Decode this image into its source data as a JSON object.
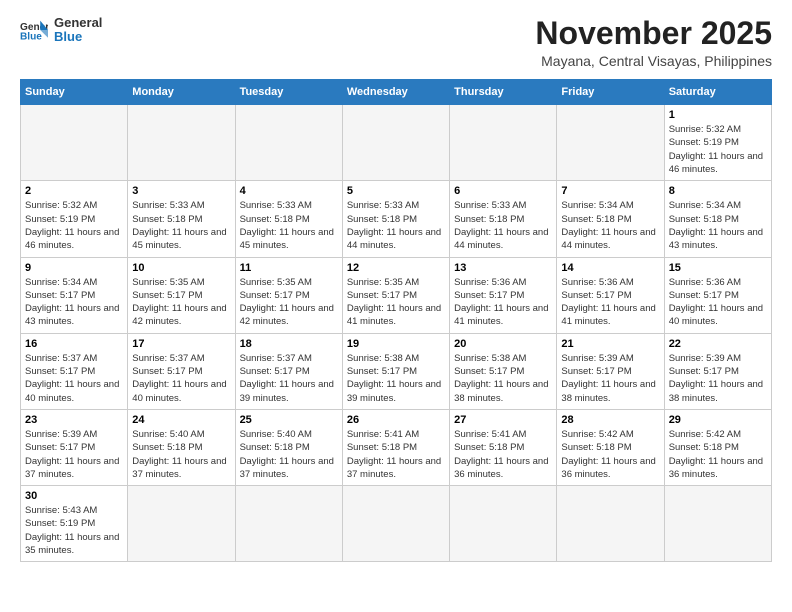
{
  "header": {
    "logo_general": "General",
    "logo_blue": "Blue",
    "month_title": "November 2025",
    "location": "Mayana, Central Visayas, Philippines"
  },
  "days_of_week": [
    "Sunday",
    "Monday",
    "Tuesday",
    "Wednesday",
    "Thursday",
    "Friday",
    "Saturday"
  ],
  "weeks": [
    [
      {
        "day": "",
        "empty": true
      },
      {
        "day": "",
        "empty": true
      },
      {
        "day": "",
        "empty": true
      },
      {
        "day": "",
        "empty": true
      },
      {
        "day": "",
        "empty": true
      },
      {
        "day": "",
        "empty": true
      },
      {
        "day": "1",
        "sunrise": "5:32 AM",
        "sunset": "5:19 PM",
        "daylight": "11 hours and 46 minutes."
      }
    ],
    [
      {
        "day": "2",
        "sunrise": "5:32 AM",
        "sunset": "5:19 PM",
        "daylight": "11 hours and 46 minutes."
      },
      {
        "day": "3",
        "sunrise": "5:33 AM",
        "sunset": "5:18 PM",
        "daylight": "11 hours and 45 minutes."
      },
      {
        "day": "4",
        "sunrise": "5:33 AM",
        "sunset": "5:18 PM",
        "daylight": "11 hours and 45 minutes."
      },
      {
        "day": "5",
        "sunrise": "5:33 AM",
        "sunset": "5:18 PM",
        "daylight": "11 hours and 44 minutes."
      },
      {
        "day": "6",
        "sunrise": "5:33 AM",
        "sunset": "5:18 PM",
        "daylight": "11 hours and 44 minutes."
      },
      {
        "day": "7",
        "sunrise": "5:34 AM",
        "sunset": "5:18 PM",
        "daylight": "11 hours and 44 minutes."
      },
      {
        "day": "8",
        "sunrise": "5:34 AM",
        "sunset": "5:18 PM",
        "daylight": "11 hours and 43 minutes."
      }
    ],
    [
      {
        "day": "9",
        "sunrise": "5:34 AM",
        "sunset": "5:17 PM",
        "daylight": "11 hours and 43 minutes."
      },
      {
        "day": "10",
        "sunrise": "5:35 AM",
        "sunset": "5:17 PM",
        "daylight": "11 hours and 42 minutes."
      },
      {
        "day": "11",
        "sunrise": "5:35 AM",
        "sunset": "5:17 PM",
        "daylight": "11 hours and 42 minutes."
      },
      {
        "day": "12",
        "sunrise": "5:35 AM",
        "sunset": "5:17 PM",
        "daylight": "11 hours and 41 minutes."
      },
      {
        "day": "13",
        "sunrise": "5:36 AM",
        "sunset": "5:17 PM",
        "daylight": "11 hours and 41 minutes."
      },
      {
        "day": "14",
        "sunrise": "5:36 AM",
        "sunset": "5:17 PM",
        "daylight": "11 hours and 41 minutes."
      },
      {
        "day": "15",
        "sunrise": "5:36 AM",
        "sunset": "5:17 PM",
        "daylight": "11 hours and 40 minutes."
      }
    ],
    [
      {
        "day": "16",
        "sunrise": "5:37 AM",
        "sunset": "5:17 PM",
        "daylight": "11 hours and 40 minutes."
      },
      {
        "day": "17",
        "sunrise": "5:37 AM",
        "sunset": "5:17 PM",
        "daylight": "11 hours and 40 minutes."
      },
      {
        "day": "18",
        "sunrise": "5:37 AM",
        "sunset": "5:17 PM",
        "daylight": "11 hours and 39 minutes."
      },
      {
        "day": "19",
        "sunrise": "5:38 AM",
        "sunset": "5:17 PM",
        "daylight": "11 hours and 39 minutes."
      },
      {
        "day": "20",
        "sunrise": "5:38 AM",
        "sunset": "5:17 PM",
        "daylight": "11 hours and 38 minutes."
      },
      {
        "day": "21",
        "sunrise": "5:39 AM",
        "sunset": "5:17 PM",
        "daylight": "11 hours and 38 minutes."
      },
      {
        "day": "22",
        "sunrise": "5:39 AM",
        "sunset": "5:17 PM",
        "daylight": "11 hours and 38 minutes."
      }
    ],
    [
      {
        "day": "23",
        "sunrise": "5:39 AM",
        "sunset": "5:17 PM",
        "daylight": "11 hours and 37 minutes."
      },
      {
        "day": "24",
        "sunrise": "5:40 AM",
        "sunset": "5:18 PM",
        "daylight": "11 hours and 37 minutes."
      },
      {
        "day": "25",
        "sunrise": "5:40 AM",
        "sunset": "5:18 PM",
        "daylight": "11 hours and 37 minutes."
      },
      {
        "day": "26",
        "sunrise": "5:41 AM",
        "sunset": "5:18 PM",
        "daylight": "11 hours and 37 minutes."
      },
      {
        "day": "27",
        "sunrise": "5:41 AM",
        "sunset": "5:18 PM",
        "daylight": "11 hours and 36 minutes."
      },
      {
        "day": "28",
        "sunrise": "5:42 AM",
        "sunset": "5:18 PM",
        "daylight": "11 hours and 36 minutes."
      },
      {
        "day": "29",
        "sunrise": "5:42 AM",
        "sunset": "5:18 PM",
        "daylight": "11 hours and 36 minutes."
      }
    ],
    [
      {
        "day": "30",
        "sunrise": "5:43 AM",
        "sunset": "5:19 PM",
        "daylight": "11 hours and 35 minutes."
      },
      {
        "day": "",
        "empty": true
      },
      {
        "day": "",
        "empty": true
      },
      {
        "day": "",
        "empty": true
      },
      {
        "day": "",
        "empty": true
      },
      {
        "day": "",
        "empty": true
      },
      {
        "day": "",
        "empty": true
      }
    ]
  ],
  "labels": {
    "sunrise_prefix": "Sunrise: ",
    "sunset_prefix": "Sunset: ",
    "daylight_prefix": "Daylight: "
  }
}
